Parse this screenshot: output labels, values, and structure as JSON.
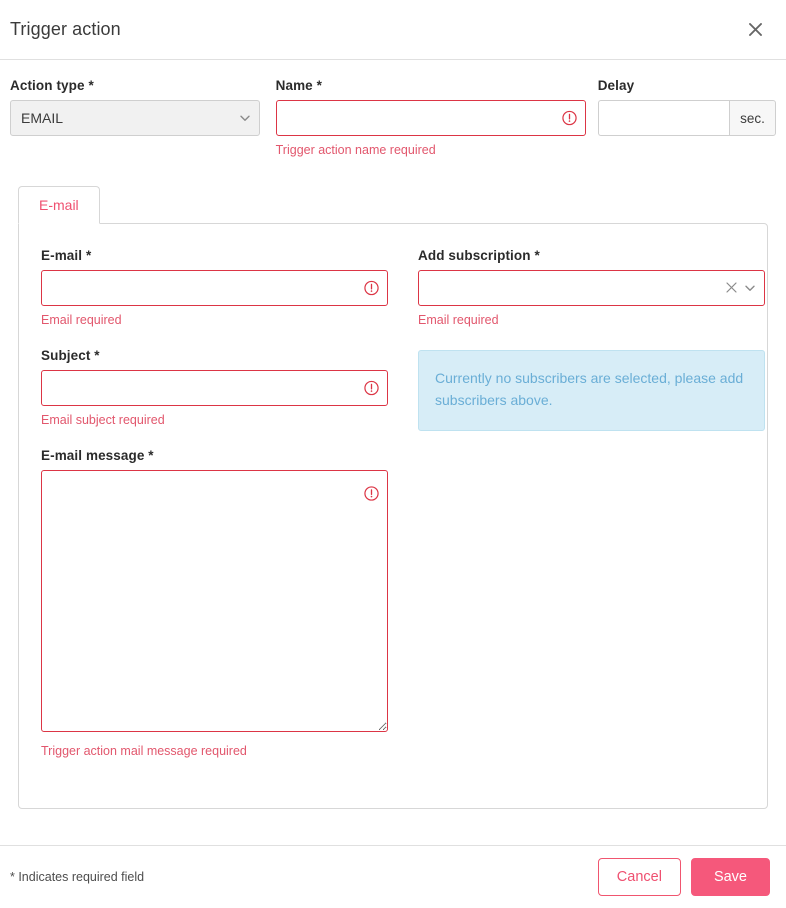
{
  "dialog": {
    "title": "Trigger action",
    "close_icon": "close-icon"
  },
  "top_row": {
    "action_type": {
      "label": "Action type *",
      "value": "EMAIL",
      "chevron_icon": "chevron-down-icon"
    },
    "name": {
      "label": "Name *",
      "value": "",
      "error": "Trigger action name required",
      "error_icon": "exclamation-circle-icon"
    },
    "delay": {
      "label": "Delay",
      "value": "",
      "suffix": "sec."
    }
  },
  "tabs": [
    {
      "label": "E-mail",
      "active": true
    }
  ],
  "panel": {
    "left": {
      "email": {
        "label": "E-mail *",
        "value": "",
        "error": "Email required",
        "error_icon": "exclamation-circle-icon"
      },
      "subject": {
        "label": "Subject *",
        "value": "",
        "error": "Email subject required",
        "error_icon": "exclamation-circle-icon"
      },
      "message": {
        "label": "E-mail message *",
        "value": "",
        "error": "Trigger action mail message required",
        "error_icon": "exclamation-circle-icon"
      }
    },
    "right": {
      "subscription": {
        "label": "Add subscription *",
        "value": "",
        "error": "Email required",
        "clear_icon": "clear-icon",
        "chevron_icon": "chevron-down-icon"
      },
      "info": "Currently no subscribers are selected, please add subscribers above."
    }
  },
  "footer": {
    "required_note": "* Indicates required field",
    "cancel_label": "Cancel",
    "save_label": "Save"
  },
  "colors": {
    "accent": "#f5587b",
    "error": "#dc3545",
    "error_text": "#e2576d",
    "info_bg": "#d7edf7",
    "info_text": "#6aaed6",
    "tab_active_text": "#ef5070"
  }
}
